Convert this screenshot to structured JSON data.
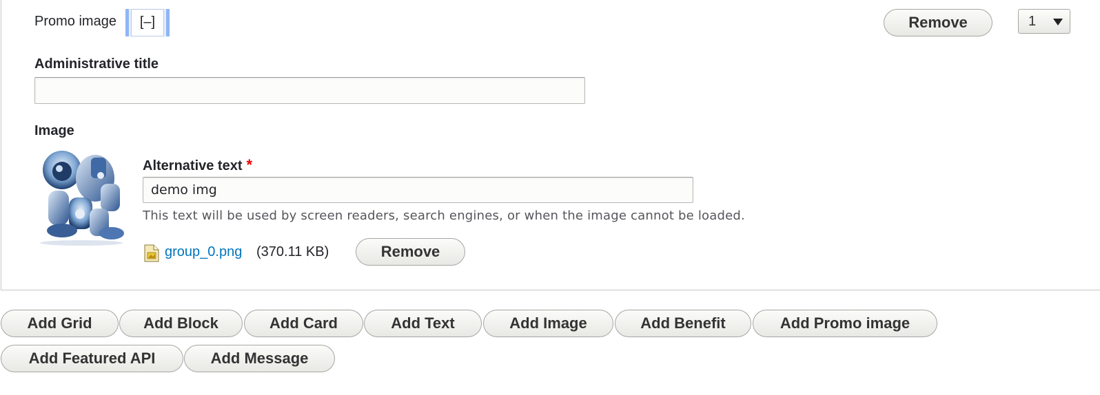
{
  "paragraph": {
    "label": "Promo image",
    "toggle_label": "[–]",
    "remove_label": "Remove",
    "weight_value": "1"
  },
  "admin_title": {
    "label": "Administrative title",
    "value": ""
  },
  "image": {
    "label": "Image",
    "alt_label": "Alternative text",
    "required_mark": "*",
    "alt_value": "demo img",
    "description": "This text will be used by screen readers, search engines, or when the image cannot be loaded.",
    "file_name": "group_0.png",
    "file_size": "(370.11 KB)",
    "remove_label": "Remove"
  },
  "add_buttons": [
    "Add Grid",
    "Add Block",
    "Add Card",
    "Add Text",
    "Add Image",
    "Add Benefit",
    "Add Promo image",
    "Add Featured API",
    "Add Message"
  ],
  "colors": {
    "link": "#0074bd",
    "required": "#ee0000",
    "focus_highlight": "#8eb6f5"
  }
}
